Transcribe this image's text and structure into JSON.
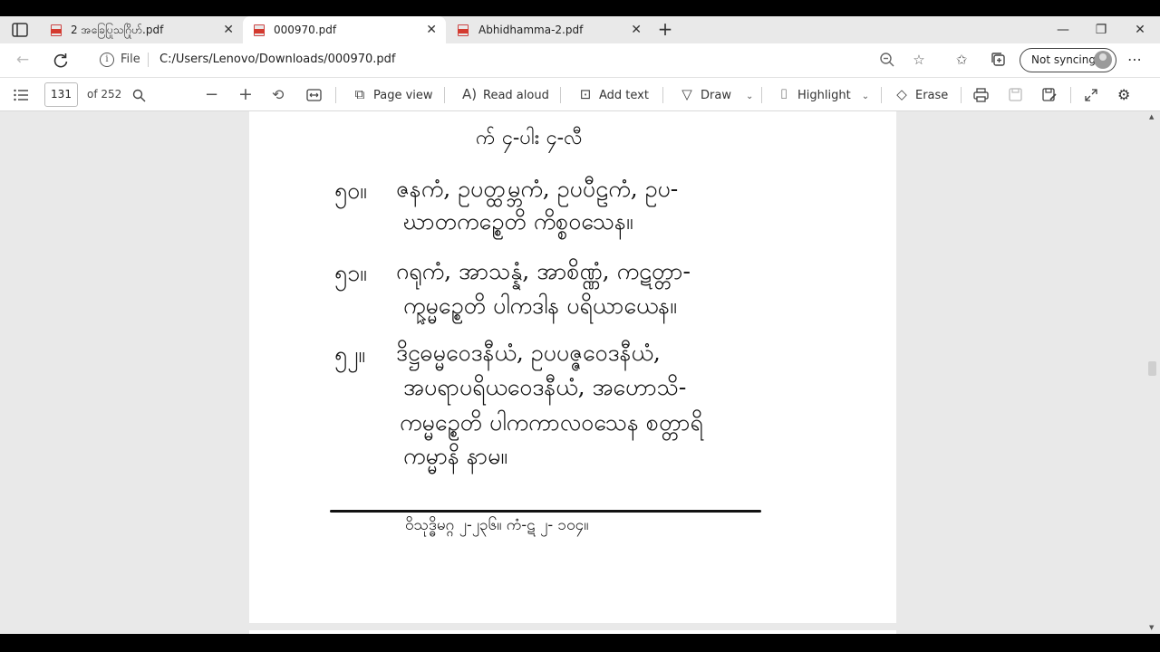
{
  "tabs": [
    {
      "title": "2 အခြေပြုသဂြိုဟ်.pdf",
      "close": "✕"
    },
    {
      "title": "000970.pdf",
      "close": "✕"
    },
    {
      "title": "Abhidhamma-2.pdf",
      "close": "✕"
    }
  ],
  "window": {
    "minimize": "—",
    "restore": "❐",
    "close": "✕",
    "new_tab": "+"
  },
  "address": {
    "file_label": "File",
    "url": "C:/Users/Lenovo/Downloads/000970.pdf",
    "sync_label": "Not syncing"
  },
  "pdf_toolbar": {
    "page_number": "131",
    "page_total": "of 252",
    "page_view": "Page view",
    "read_aloud": "Read aloud",
    "add_text": "Add text",
    "draw": "Draw",
    "highlight": "Highlight",
    "erase": "Erase"
  },
  "document": {
    "heading": "က် ၄-ပါး ၄-လီ",
    "entries": [
      {
        "num": "၅၀။",
        "lines": [
          "ဇနကံ, ဥပတ္ထမ္ဘကံ, ဥပပီဠကံ, ဥပ-",
          "ဃာတကဥ္စေတိ ကိစ္စဝသေန။"
        ]
      },
      {
        "num": "၅၁။",
        "lines": [
          "ဂရုကံ, အာသန္နံ, အာစိဏ္ဏံ, ကဋတ္တာ-",
          "ကမ္မဥ္စေတိ ပါကဒါန ပရိယာယေန။"
        ]
      },
      {
        "num": "၅၂။",
        "lines": [
          "ဒိဋ္ဌဓမ္မဝေဒနီယံ, ဥပပဇ္ဇဝေဒနီယံ,",
          "အပရာပရိယဝေဒနီယံ, အဟောသိ-",
          "ကမ္မဥ္စေတိ ပါကကာလဝသေန စတ္တာရိ",
          "ကမ္မာနိ နာမ။"
        ]
      }
    ],
    "footnote": "ဝိသုဒ္ဓိမဂ္ဂ ၂-၂၃၆။ ကံ-ဋ ၂- ၁၀၄။"
  }
}
